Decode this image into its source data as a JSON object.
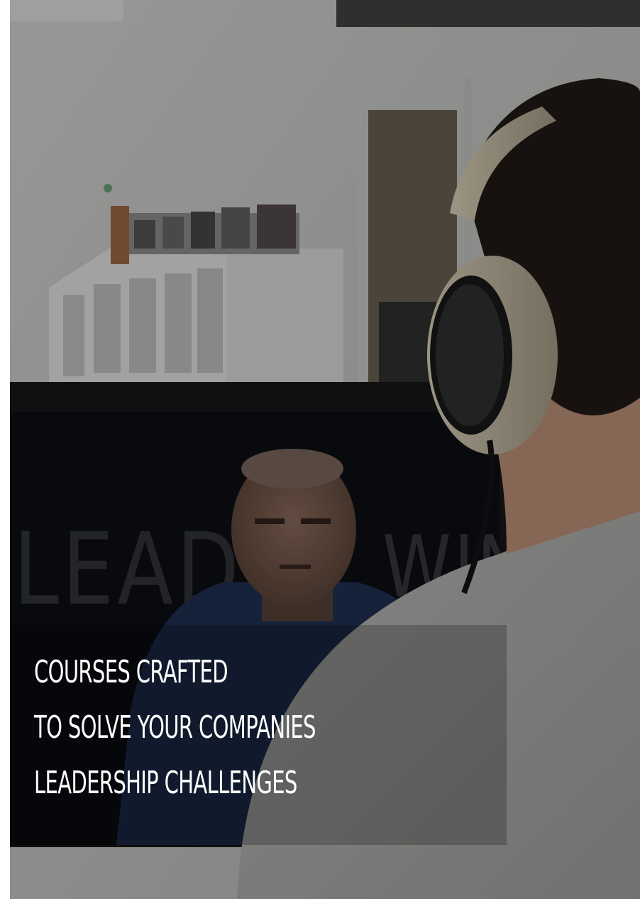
{
  "hero": {
    "headline_lines": [
      "COURSES CRAFTED",
      "TO SOLVE YOUR COMPANIES",
      "LEADERSHIP CHALLENGES"
    ],
    "screen_watermark": "LEAD WIN",
    "image_alt": "Person wearing headphones watching a leadership course video on a monitor"
  },
  "colors": {
    "headline_text": "#ffffff",
    "overlay": "#000000"
  }
}
